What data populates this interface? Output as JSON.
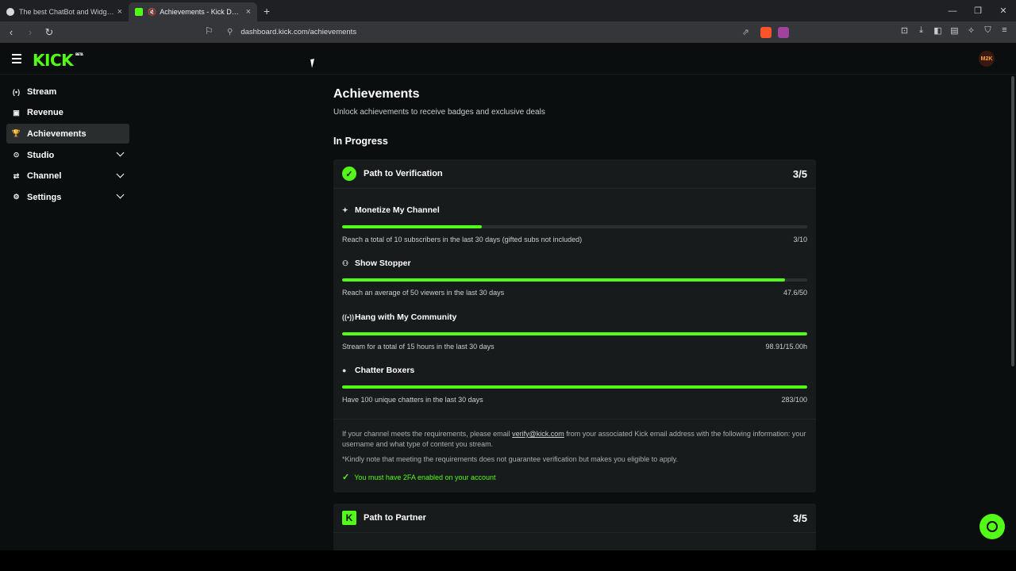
{
  "browser": {
    "tabs": [
      {
        "title": "The best ChatBot and Widgets for Kick",
        "active": false,
        "close": "×"
      },
      {
        "title": "Achievements - Kick Dashboard",
        "active": true,
        "close": "×"
      }
    ],
    "new_tab": "+",
    "url": "dashboard.kick.com/achievements",
    "window_controls": [
      "—",
      "❐",
      "✕"
    ]
  },
  "header": {
    "logo": "KICK",
    "logo_badge": "BETA",
    "avatar_text": "M2K"
  },
  "sidebar": {
    "items": [
      {
        "label": "Stream",
        "icon": "(•)",
        "icon_name": "broadcast-icon",
        "expandable": false
      },
      {
        "label": "Revenue",
        "icon": "▣",
        "icon_name": "revenue-icon",
        "expandable": false
      },
      {
        "label": "Achievements",
        "icon": "🏆",
        "icon_name": "trophy-icon",
        "expandable": false,
        "active": true
      },
      {
        "label": "Studio",
        "icon": "⊙",
        "icon_name": "studio-icon",
        "expandable": true
      },
      {
        "label": "Channel",
        "icon": "⇄",
        "icon_name": "channel-icon",
        "expandable": true
      },
      {
        "label": "Settings",
        "icon": "⚙",
        "icon_name": "gear-icon",
        "expandable": true
      }
    ]
  },
  "main": {
    "title": "Achievements",
    "subtitle": "Unlock achievements to receive badges and exclusive deals",
    "section": "In Progress",
    "verification": {
      "title": "Path to Verification",
      "count": "3/5",
      "achievements": [
        {
          "title": "Monetize My Channel",
          "icon": "✦",
          "desc": "Reach a total of 10 subscribers in the last 30 days (gifted subs not included)",
          "value": "3/10",
          "progress": 0.3
        },
        {
          "title": "Show Stopper",
          "icon": "⚇",
          "desc": "Reach an average of 50 viewers in the last 30 days",
          "value": "47.6/50",
          "progress": 0.952
        },
        {
          "title": "Hang with My Community",
          "icon": "((•))",
          "desc": "Stream for a total of 15 hours in the last 30 days",
          "value": "98.91/15.00h",
          "progress": 1.0
        },
        {
          "title": "Chatter Boxers",
          "icon": "●",
          "desc": "Have 100 unique chatters in the last 30 days",
          "value": "283/100",
          "progress": 1.0
        }
      ],
      "note_before": "If your channel meets the requirements, please email ",
      "note_email": "verify@kick.com",
      "note_after": " from your associated Kick email address with the following information: your username and what type of content you stream.",
      "note2": "*Kindly note that meeting the requirements does not guarantee verification but makes you eligible to apply.",
      "requirement": "You must have 2FA enabled on your account"
    },
    "partner": {
      "title": "Path to Partner",
      "count": "3/5"
    }
  },
  "colors": {
    "accent": "#53fc18",
    "background": "#0b0e0f",
    "card": "#181b1c"
  }
}
